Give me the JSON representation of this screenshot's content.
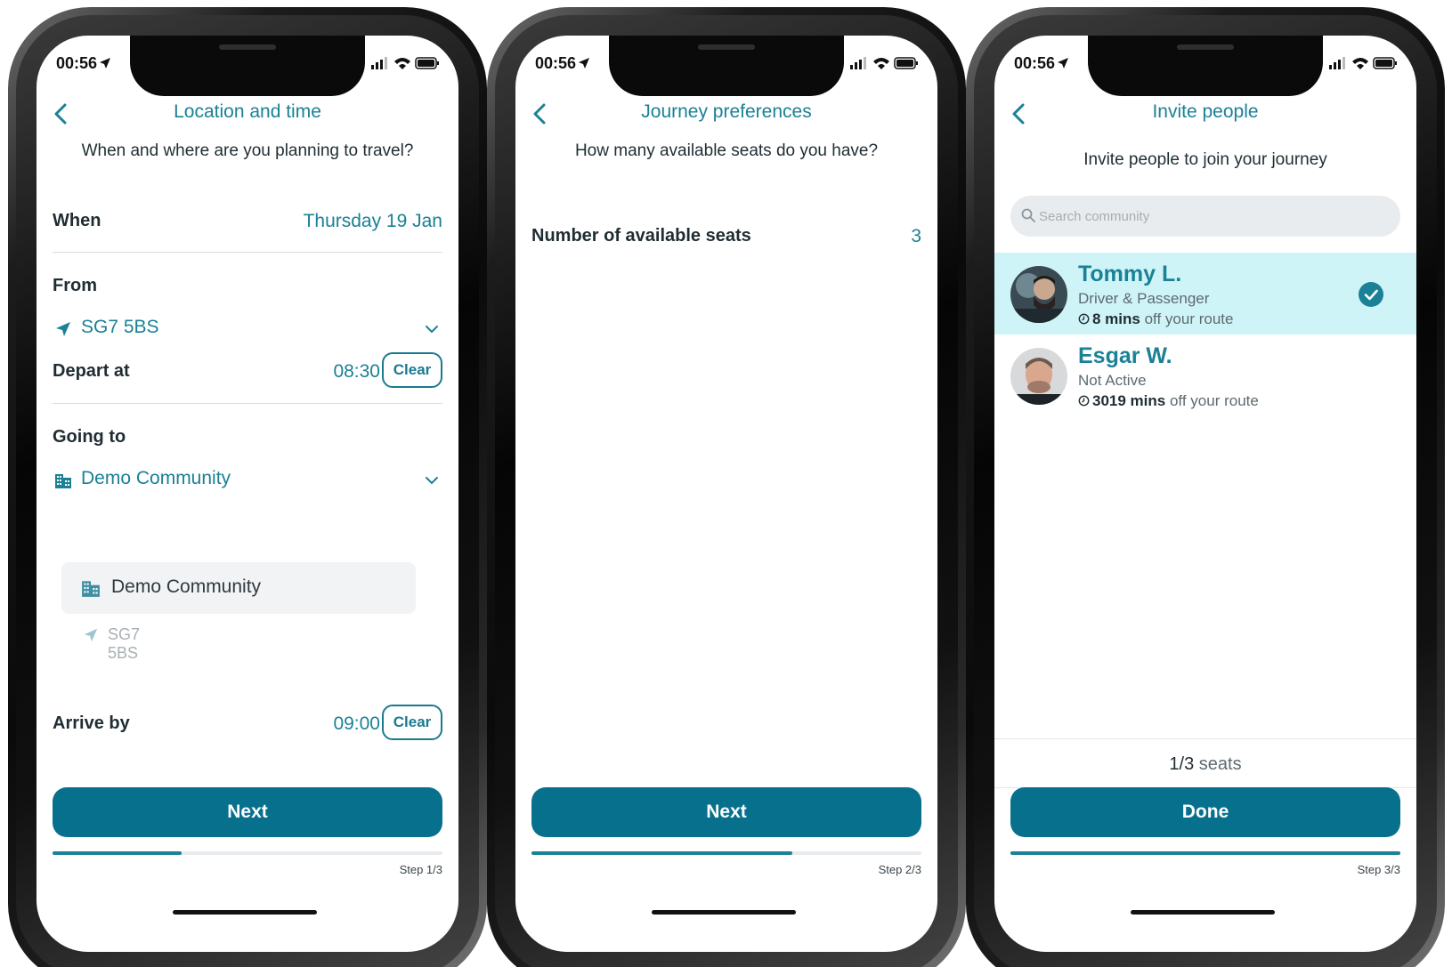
{
  "status_bar": {
    "time": "00:56"
  },
  "screen1": {
    "title": "Location and time",
    "subtitle": "When and where are you planning to travel?",
    "when_label": "When",
    "when_value": "Thursday 19 Jan",
    "from_label": "From",
    "from_value": "SG7 5BS",
    "depart_label": "Depart at",
    "depart_time": "08:30",
    "clear_label": "Clear",
    "going_label": "Going to",
    "going_value": "Demo Community",
    "suggestions": [
      "Demo Community",
      "SG7 5BS"
    ],
    "arrive_label": "Arrive by",
    "arrive_time": "09:00",
    "next_label": "Next",
    "progress": 0.33,
    "step_label": "Step 1/3"
  },
  "screen2": {
    "title": "Journey preferences",
    "subtitle": "How many available seats do you have?",
    "seats_label": "Number of available seats",
    "seats_value": "3",
    "next_label": "Next",
    "progress": 0.67,
    "step_label": "Step 2/3"
  },
  "screen3": {
    "title": "Invite people",
    "subtitle": "Invite people to join your journey",
    "search_placeholder": "Search community",
    "people": [
      {
        "name": "Tommy L.",
        "role": "Driver & Passenger",
        "route_time": "8 mins",
        "route_suffix": "off your route",
        "selected": true
      },
      {
        "name": "Esgar W.",
        "role": "Not Active",
        "route_time": "3019 mins",
        "route_suffix": "off your route",
        "selected": false
      }
    ],
    "seats_count": "1/3",
    "seats_unit": "seats",
    "done_label": "Done",
    "progress": 1.0,
    "step_label": "Step 3/3"
  },
  "icons": {
    "back": "chevron-left-icon",
    "location": "location-arrow-icon",
    "building": "building-icon",
    "dropdown": "chevron-down-icon",
    "search": "search-icon",
    "clock": "clock-icon",
    "check": "check-circle-icon"
  },
  "colors": {
    "accent": "#1a8196",
    "button": "#07718d",
    "selected_row": "#cff4f8"
  }
}
